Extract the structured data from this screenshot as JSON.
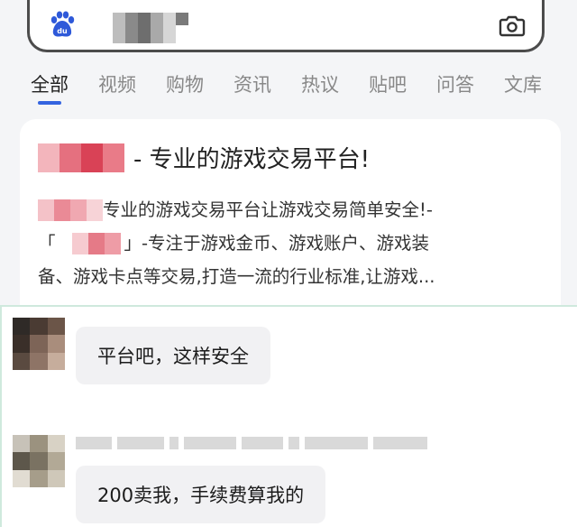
{
  "search": {
    "logo_text": "du",
    "logo_color": "#2e59d9"
  },
  "tabs": [
    "全部",
    "视频",
    "购物",
    "资讯",
    "热议",
    "贴吧",
    "问答",
    "文库"
  ],
  "active_tab": 0,
  "accent_color": "#3464e0",
  "result": {
    "title_suffix": "- 专业的游戏交易平台!",
    "desc_line1": "专业的游戏交易平台让游戏交易简单安全!-",
    "desc_line2_open": "「",
    "desc_line2_rest": "」-专注于游戏金币、游戏账户、游戏装",
    "desc_line3": "备、游戏卡点等交易,打造一流的行业标准,让游戏..."
  },
  "chat": {
    "messages": [
      {
        "text": "平台吧，这样安全"
      },
      {
        "text": "200卖我，手续费算我的"
      }
    ]
  }
}
